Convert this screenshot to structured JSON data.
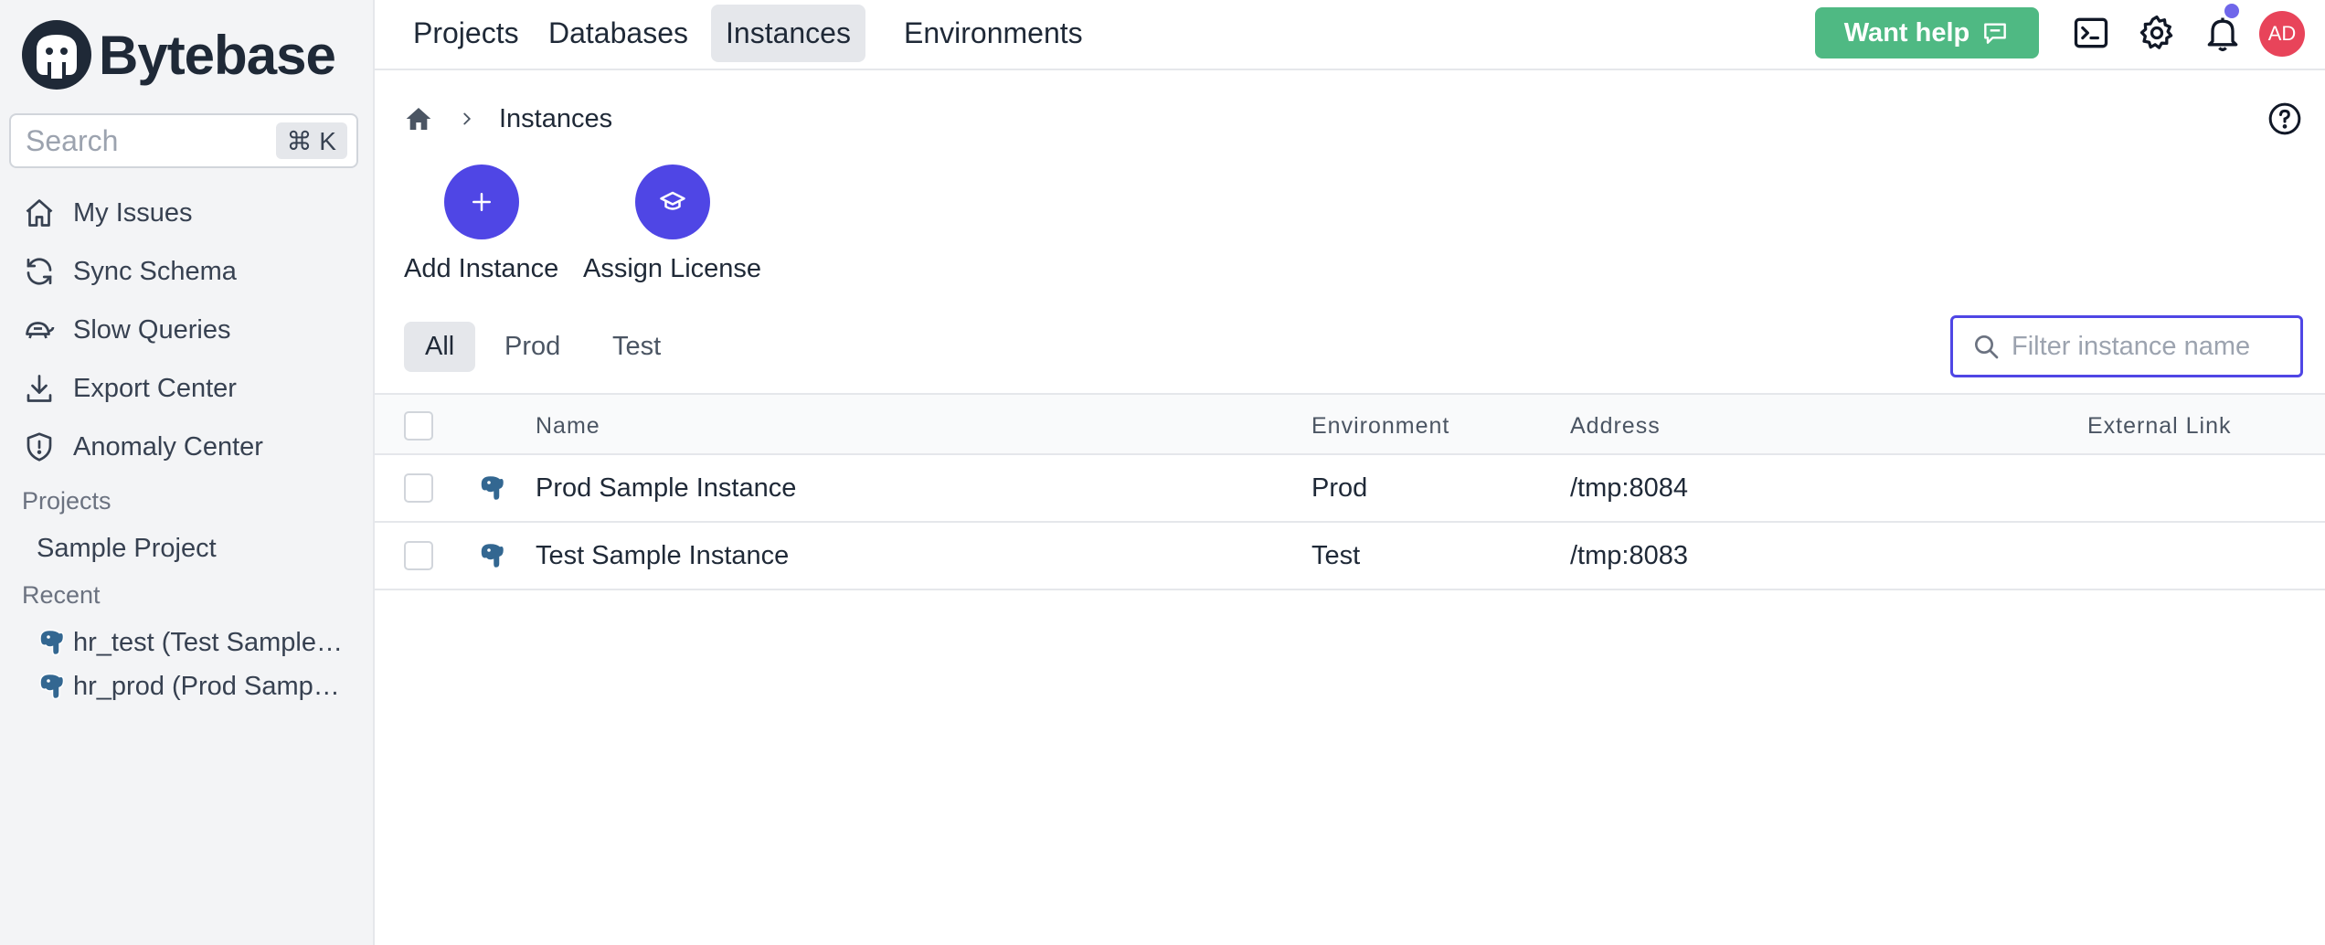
{
  "brand": {
    "name": "Bytebase"
  },
  "sidebar": {
    "search_placeholder": "Search",
    "search_shortcut": "⌘ K",
    "nav": [
      {
        "label": "My Issues",
        "icon": "home-icon"
      },
      {
        "label": "Sync Schema",
        "icon": "refresh-icon"
      },
      {
        "label": "Slow Queries",
        "icon": "turtle-icon"
      },
      {
        "label": "Export Center",
        "icon": "download-icon"
      },
      {
        "label": "Anomaly Center",
        "icon": "shield-icon"
      }
    ],
    "projects_title": "Projects",
    "projects": [
      {
        "label": "Sample Project"
      }
    ],
    "recent_title": "Recent",
    "recent": [
      {
        "label": "hr_test (Test Sample Instance)"
      },
      {
        "label": "hr_prod (Prod Sample Instance)"
      }
    ]
  },
  "header": {
    "tabs": [
      {
        "label": "Projects",
        "active": false
      },
      {
        "label": "Databases",
        "active": false
      },
      {
        "label": "Instances",
        "active": true
      },
      {
        "label": "Environments",
        "active": false
      }
    ],
    "help_label": "Want help",
    "avatar_initials": "AD"
  },
  "breadcrumb": {
    "current": "Instances"
  },
  "actions": [
    {
      "label": "Add Instance",
      "icon": "plus-icon"
    },
    {
      "label": "Assign License",
      "icon": "graduation-cap-icon"
    }
  ],
  "env_tabs": [
    {
      "label": "All",
      "active": true
    },
    {
      "label": "Prod",
      "active": false
    },
    {
      "label": "Test",
      "active": false
    }
  ],
  "filter": {
    "placeholder": "Filter instance name"
  },
  "table": {
    "columns": {
      "name": "Name",
      "environment": "Environment",
      "address": "Address",
      "external": "External Link"
    },
    "rows": [
      {
        "name": "Prod Sample Instance",
        "environment": "Prod",
        "address": "/tmp:8084",
        "external": ""
      },
      {
        "name": "Test Sample Instance",
        "environment": "Test",
        "address": "/tmp:8083",
        "external": ""
      }
    ]
  },
  "colors": {
    "accent": "#4f46e5",
    "help_button": "#4fb983",
    "avatar": "#e8445a",
    "notification_dot": "#6f66ea"
  }
}
